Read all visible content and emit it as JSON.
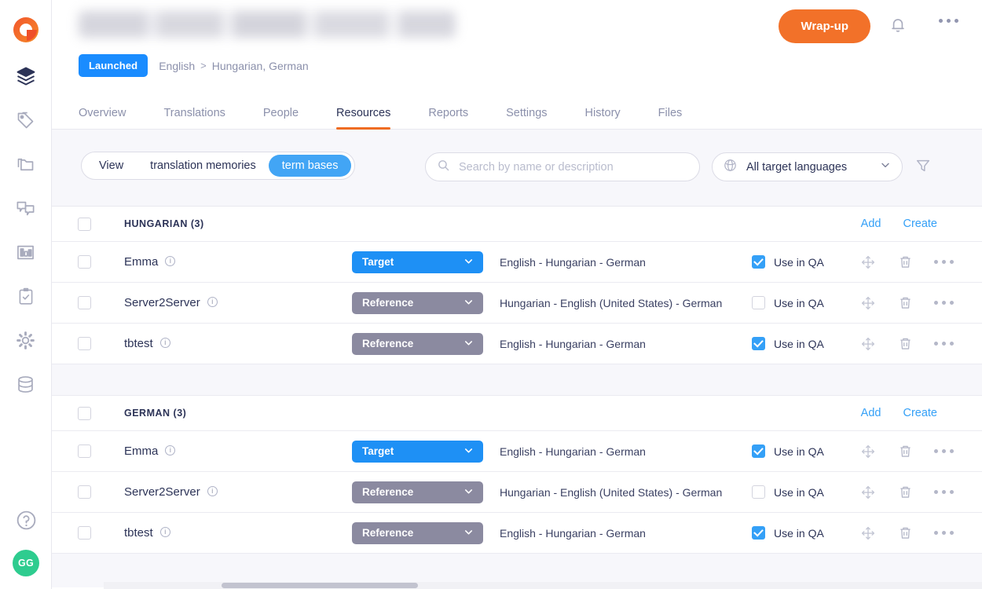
{
  "app": {
    "logo_icon": "phrase-logo-icon",
    "avatar_initials": "GG"
  },
  "rail": {
    "items": [
      {
        "icon": "layers-icon",
        "name": "projects"
      },
      {
        "icon": "tag-icon",
        "name": "jobs"
      },
      {
        "icon": "folders-icon",
        "name": "files"
      },
      {
        "icon": "chat-bubbles-icon",
        "name": "conversations"
      },
      {
        "icon": "bar-chart-icon",
        "name": "analytics"
      },
      {
        "icon": "clipboard-check-icon",
        "name": "quality"
      },
      {
        "icon": "gear-icon",
        "name": "settings"
      },
      {
        "icon": "database-icon",
        "name": "resources"
      }
    ],
    "help_icon": "help-circle-icon"
  },
  "header": {
    "project_title_redacted": "",
    "status_badge": "Launched",
    "breadcrumb_source": "English",
    "breadcrumb_separator": ">",
    "breadcrumb_targets": "Hungarian, German",
    "wrapup_label": "Wrap-up",
    "bell_icon": "bell-icon",
    "more_icon": "more-horizontal-icon"
  },
  "tabs": [
    {
      "label": "Overview",
      "active": false
    },
    {
      "label": "Translations",
      "active": false
    },
    {
      "label": "People",
      "active": false
    },
    {
      "label": "Resources",
      "active": true
    },
    {
      "label": "Reports",
      "active": false
    },
    {
      "label": "Settings",
      "active": false
    },
    {
      "label": "History",
      "active": false
    },
    {
      "label": "Files",
      "active": false
    }
  ],
  "toolbar": {
    "view_label": "View",
    "view_options": [
      {
        "label": "translation memories",
        "selected": false
      },
      {
        "label": "term bases",
        "selected": true
      }
    ],
    "search": {
      "placeholder": "Search by name or description",
      "value": "",
      "icon": "search-icon"
    },
    "language_filter": {
      "value": "All target languages",
      "icon": "globe-icon",
      "chevron": "chevron-down-icon"
    },
    "filter_icon": "funnel-icon"
  },
  "groups": [
    {
      "title": "HUNGARIAN (3)",
      "checked": false,
      "add_label": "Add",
      "create_label": "Create",
      "rows": [
        {
          "checked": false,
          "name": "Emma",
          "info_icon": "info-icon",
          "type": "Target",
          "type_style": "target",
          "languages": "English - Hungarian - German",
          "qa_label": "Use in QA",
          "qa_checked": true
        },
        {
          "checked": false,
          "name": "Server2Server",
          "info_icon": "info-icon",
          "type": "Reference",
          "type_style": "reference",
          "languages": "Hungarian - English (United States) - German",
          "qa_label": "Use in QA",
          "qa_checked": false
        },
        {
          "checked": false,
          "name": "tbtest",
          "info_icon": "info-icon",
          "type": "Reference",
          "type_style": "reference",
          "languages": "English - Hungarian - German",
          "qa_label": "Use in QA",
          "qa_checked": true
        }
      ]
    },
    {
      "title": "GERMAN (3)",
      "checked": false,
      "add_label": "Add",
      "create_label": "Create",
      "rows": [
        {
          "checked": false,
          "name": "Emma",
          "info_icon": "info-icon",
          "type": "Target",
          "type_style": "target",
          "languages": "English - Hungarian - German",
          "qa_label": "Use in QA",
          "qa_checked": true
        },
        {
          "checked": false,
          "name": "Server2Server",
          "info_icon": "info-icon",
          "type": "Reference",
          "type_style": "reference",
          "languages": "Hungarian - English (United States) - German",
          "qa_label": "Use in QA",
          "qa_checked": false
        },
        {
          "checked": false,
          "name": "tbtest",
          "info_icon": "info-icon",
          "type": "Reference",
          "type_style": "reference",
          "languages": "English - Hungarian - German",
          "qa_label": "Use in QA",
          "qa_checked": true
        }
      ]
    }
  ],
  "row_actions": {
    "move_icon": "move-arrows-icon",
    "delete_icon": "trash-icon",
    "more_icon": "more-horizontal-icon"
  },
  "colors": {
    "accent_orange": "#f27129",
    "accent_blue": "#1a8cff",
    "target_pill": "#1e90f5",
    "reference_pill": "#8b8aa0",
    "link_blue": "#34a0f7",
    "avatar_green": "#2ecc8f",
    "band_bg": "#f7f7fb"
  }
}
